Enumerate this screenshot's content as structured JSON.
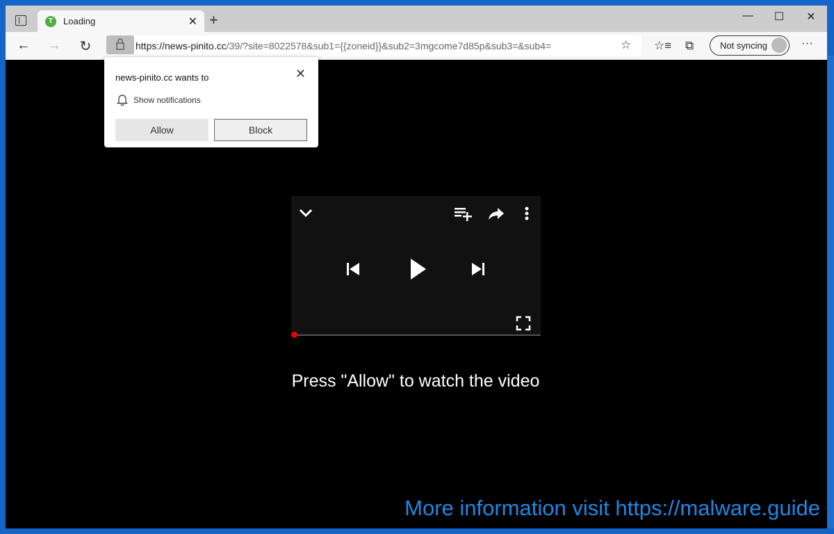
{
  "browser": {
    "tab_title": "Loading",
    "tab_favicon_letter": "T",
    "url_domain": "https://news-pinito.cc",
    "url_rest": "/39/?site=8022578&sub1={{zoneid}}&sub2=3mgcome7d85p&sub3=&sub4=",
    "sync_label": "Not syncing"
  },
  "permission_prompt": {
    "title": "news-pinito.cc wants to",
    "permission": "Show notifications",
    "allow_label": "Allow",
    "block_label": "Block"
  },
  "page": {
    "message": "Press \"Allow\" to watch the video",
    "progress": 0
  },
  "watermark": "More information visit https://malware.guide",
  "colors": {
    "accent_watermark": "#1e88e5",
    "progress_dot": "#e00000",
    "favicon": "#4caf3e"
  }
}
